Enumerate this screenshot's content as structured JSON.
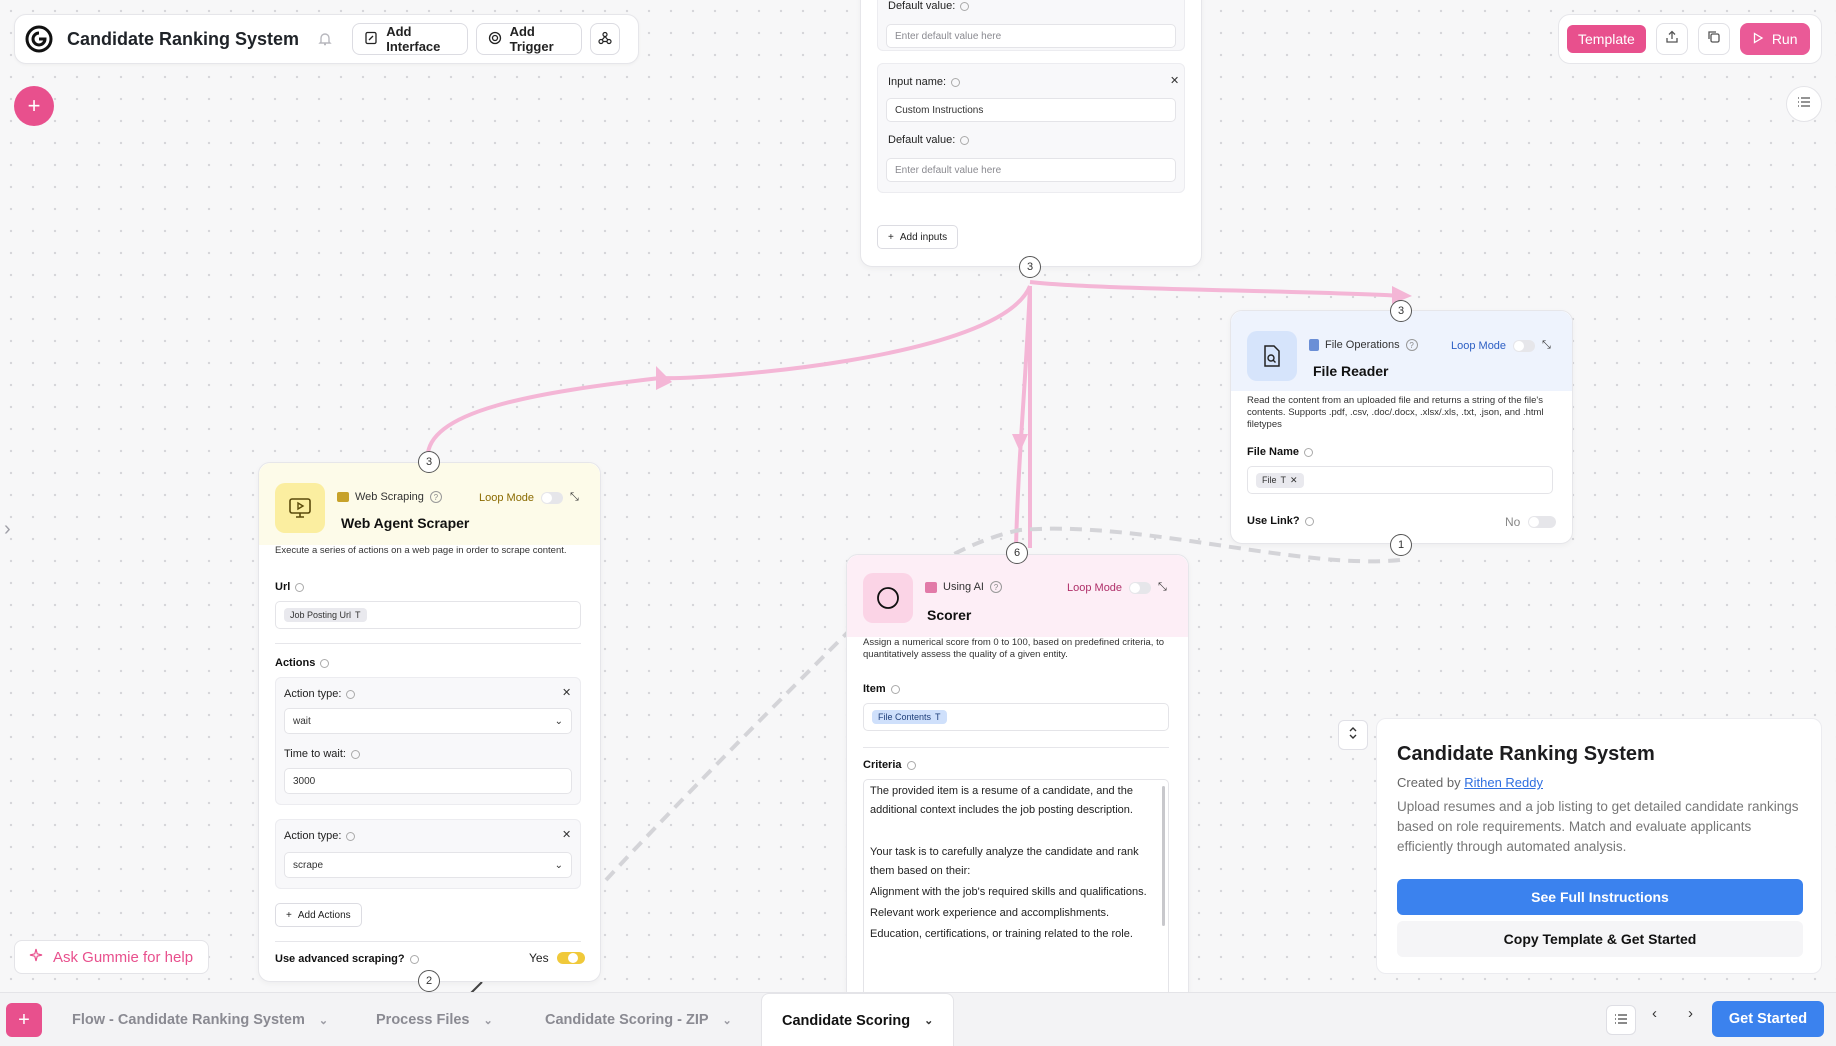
{
  "app": {
    "title": "Candidate Ranking System"
  },
  "toolbar": {
    "add_interface": "Add Interface",
    "add_trigger": "Add Trigger",
    "template": "Template",
    "run": "Run"
  },
  "input_node": {
    "default_value_label": "Default value:",
    "default_value_placeholder": "Enter default value here",
    "input_name_label": "Input name:",
    "input_name_value": "Custom Instructions",
    "add_inputs": "Add inputs",
    "port_out": "3"
  },
  "file_reader": {
    "category": "File Operations",
    "loop_mode": "Loop Mode",
    "name": "File Reader",
    "description": "Read the content from an uploaded file and returns a string of the file's contents. Supports .pdf, .csv, .doc/.docx, .xlsx/.xls, .txt, .json, and .html filetypes",
    "file_name_label": "File Name",
    "file_chip": "File",
    "use_link_label": "Use Link?",
    "use_link_value": "No",
    "port_in": "3",
    "port_out": "1"
  },
  "web_scraper": {
    "category": "Web Scraping",
    "loop_mode": "Loop Mode",
    "name": "Web Agent Scraper",
    "description": "Execute a series of actions on a web page in order to scrape content.",
    "url_label": "Url",
    "url_chip": "Job Posting Url",
    "actions_label": "Actions",
    "action1_type_label": "Action type:",
    "action1_type_value": "wait",
    "action1_time_label": "Time to wait:",
    "action1_time_value": "3000",
    "action2_type_label": "Action type:",
    "action2_type_value": "scrape",
    "add_actions": "Add Actions",
    "advanced_label": "Use advanced scraping?",
    "advanced_value": "Yes",
    "port_in": "3",
    "port_out": "2"
  },
  "scorer": {
    "category": "Using AI",
    "loop_mode": "Loop Mode",
    "name": "Scorer",
    "description": "Assign a numerical score from 0 to 100, based on predefined criteria, to quantitatively assess the quality of a given entity.",
    "item_label": "Item",
    "item_chip": "File Contents",
    "criteria_label": "Criteria",
    "criteria_lines": [
      "The provided item is a resume of a candidate, and the additional context includes the job posting description.",
      "",
      "Your task is to carefully analyze the candidate and rank them based on their:",
      "Alignment with the job's required skills and qualifications.",
      "Relevant work experience and accomplishments.",
      "Education, certifications, or training related to the role."
    ],
    "port_in": "6"
  },
  "info_panel": {
    "title": "Candidate Ranking System",
    "created_by_prefix": "Created by",
    "author": "Rithen Reddy",
    "description": "Upload resumes and a job listing to get detailed candidate rankings based on role requirements. Match and evaluate applicants efficiently through automated analysis.",
    "primary_button": "See Full Instructions",
    "secondary_button": "Copy Template & Get Started"
  },
  "help": {
    "label": "Ask Gummie for help"
  },
  "bottom_tabs": [
    {
      "label": "Flow - Candidate Ranking System"
    },
    {
      "label": "Process Files"
    },
    {
      "label": "Candidate Scoring - ZIP"
    },
    {
      "label": "Candidate Scoring"
    }
  ],
  "bottom": {
    "get_started": "Get Started"
  },
  "colors": {
    "brand_pink": "#e8508d",
    "primary_blue": "#3b82ee",
    "edge_pink": "#f4b6d6",
    "edge_gray": "#d4d4d8"
  }
}
